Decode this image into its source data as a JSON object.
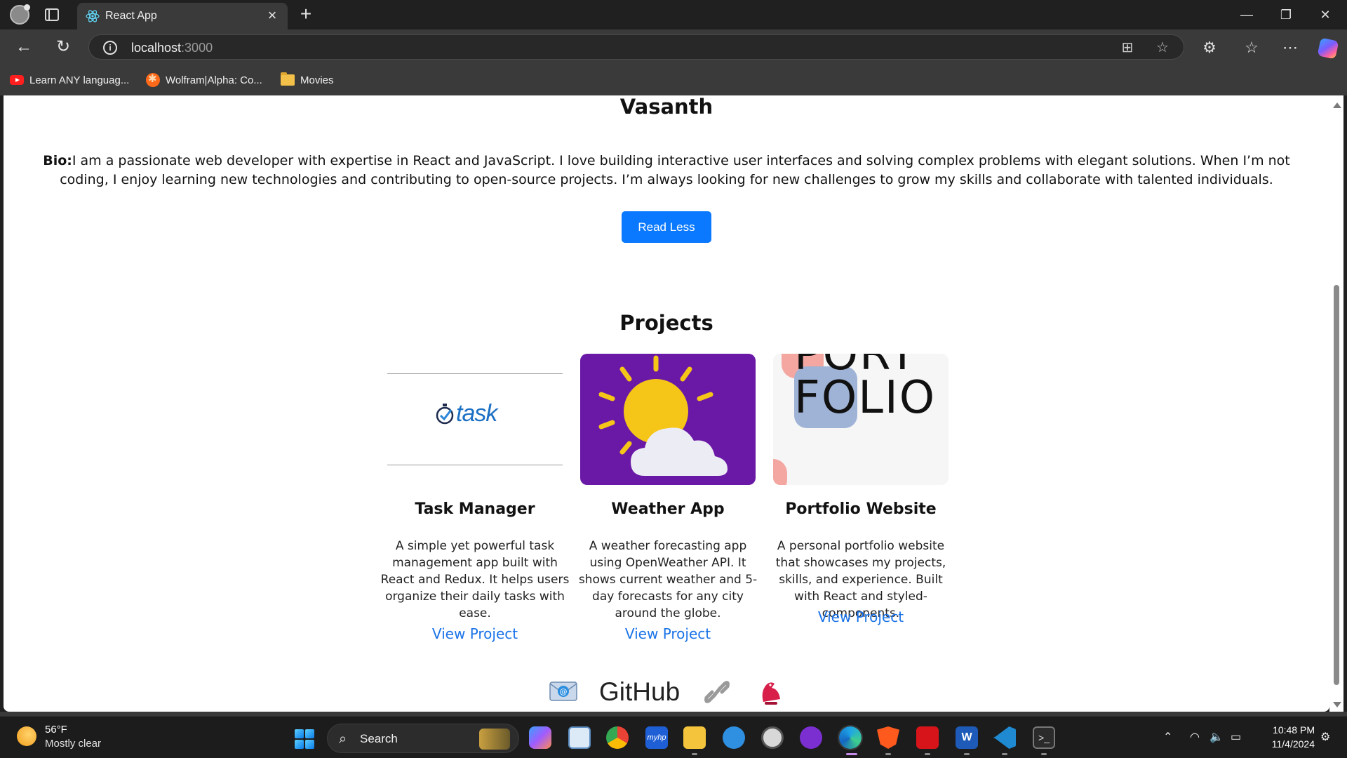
{
  "browser": {
    "tab_title": "React App",
    "url_host": "localhost",
    "url_port": ":3000",
    "bookmarks": [
      {
        "label": "Learn ANY languag...",
        "icon": "youtube-icon"
      },
      {
        "label": "Wolfram|Alpha: Co...",
        "icon": "wolfram-icon"
      },
      {
        "label": "Movies",
        "icon": "folder-icon"
      }
    ]
  },
  "page": {
    "name": "Vasanth",
    "bio_label": "Bio:",
    "bio_text": "I am a passionate web developer with expertise in React and JavaScript. I love building interactive user interfaces and solving complex problems with elegant solutions. When I’m not coding, I enjoy learning new technologies and contributing to open-source projects. I’m always looking for new challenges to grow my skills and collaborate with talented individuals.",
    "read_button": "Read Less",
    "projects_title": "Projects",
    "projects": [
      {
        "title": "Task Manager",
        "description": "A simple yet powerful task management app built with React and Redux. It helps users organize their daily tasks with ease.",
        "link": "View Project",
        "image_text": "task"
      },
      {
        "title": "Weather App",
        "description": "A weather forecasting app using OpenWeather API. It shows current weather and 5-day forecasts for any city around the globe.",
        "link": "View Project",
        "image_text": ""
      },
      {
        "title": "Portfolio Website",
        "description": "A personal portfolio website that showcases my projects, skills, and experience. Built with React and styled-components.",
        "link": "View Project",
        "image_text": "PORT FOLIO"
      }
    ],
    "footer": {
      "github_label": "GitHub"
    }
  },
  "taskbar": {
    "temperature": "56°F",
    "weather": "Mostly clear",
    "search_label": "Search",
    "time": "10:48 PM",
    "date": "11/4/2024"
  },
  "colors": {
    "primary_button": "#0b79ff",
    "link": "#1a73e8"
  }
}
